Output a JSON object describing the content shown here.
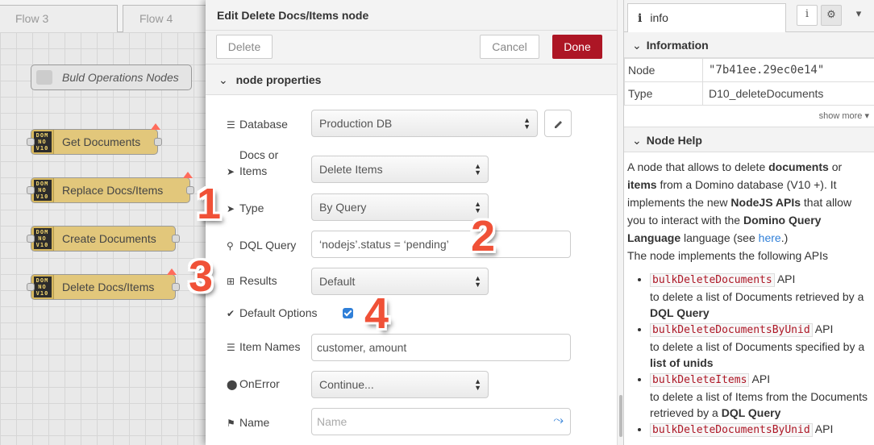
{
  "tabs": [
    {
      "label": "Flow 3"
    },
    {
      "label": "Flow 4"
    }
  ],
  "canvas": {
    "group_label": "Buld Operations Nodes",
    "node_icon_text": "DOMNOV10",
    "nodes": [
      {
        "label": "Get Documents"
      },
      {
        "label": "Replace Docs/Items"
      },
      {
        "label": "Create Documents"
      },
      {
        "label": "Delete Docs/Items"
      }
    ]
  },
  "badges": [
    "1",
    "2",
    "3",
    "4"
  ],
  "editor": {
    "title": "Edit Delete Docs/Items node",
    "delete_label": "Delete",
    "cancel_label": "Cancel",
    "done_label": "Done",
    "section_label": "node properties",
    "fields": {
      "database": {
        "label": "Database",
        "value": "Production DB"
      },
      "docs_items": {
        "label": "Docs or Items",
        "value": "Delete Items"
      },
      "type": {
        "label": "Type",
        "value": "By Query"
      },
      "dql": {
        "label": "DQL Query",
        "value": "‘nodejs’.status = ‘pending’"
      },
      "results": {
        "label": "Results",
        "value": "Default"
      },
      "default_options": {
        "label": "Default Options",
        "checked": true
      },
      "item_names": {
        "label": "Item Names",
        "value": "customer, amount"
      },
      "on_error": {
        "label": "OnError",
        "value": "Continue..."
      },
      "name": {
        "label": "Name",
        "placeholder": "Name"
      }
    }
  },
  "sidebar": {
    "tab_label": "info",
    "information_label": "Information",
    "rows": [
      {
        "key": "Node",
        "value": "\"7b41ee.29ec0e14\""
      },
      {
        "key": "Type",
        "value": "D10_deleteDocuments"
      }
    ],
    "show_more": "show more",
    "node_help_label": "Node Help",
    "help": {
      "p1_a": "A node that allows to delete ",
      "p1_b": "documents",
      "p1_c": " or ",
      "p1_d": "items",
      "p1_e": " from a Domino database (V10 +). It implements the new ",
      "p1_f": "NodeJS APIs",
      "p1_g": " that allow you to interact with the ",
      "p1_h": "Domino Query Language",
      "p1_i": " language (see ",
      "p1_link": "here",
      "p1_j": ".)",
      "p2": "The node implements the following APIs",
      "apis": [
        {
          "code": "bulkDeleteDocuments",
          "suffix": " API",
          "desc": "to delete a list of Documents retrieved by a ",
          "bold": "DQL Query"
        },
        {
          "code": "bulkDeleteDocumentsByUnid",
          "suffix": " API",
          "desc": "to delete a list of Documents specified by a ",
          "bold": "list of unids"
        },
        {
          "code": "bulkDeleteItems",
          "suffix": " API",
          "desc": "to delete a list of Items from the Documents retrieved by a ",
          "bold": "DQL Query"
        },
        {
          "code": "bulkDeleteDocumentsByUnid",
          "suffix": " API",
          "desc": "",
          "bold": ""
        }
      ]
    }
  },
  "colors": {
    "accent": "#ad1625",
    "node": "#e2c77b",
    "badge": "#f05137",
    "link": "#2f7fd8"
  }
}
